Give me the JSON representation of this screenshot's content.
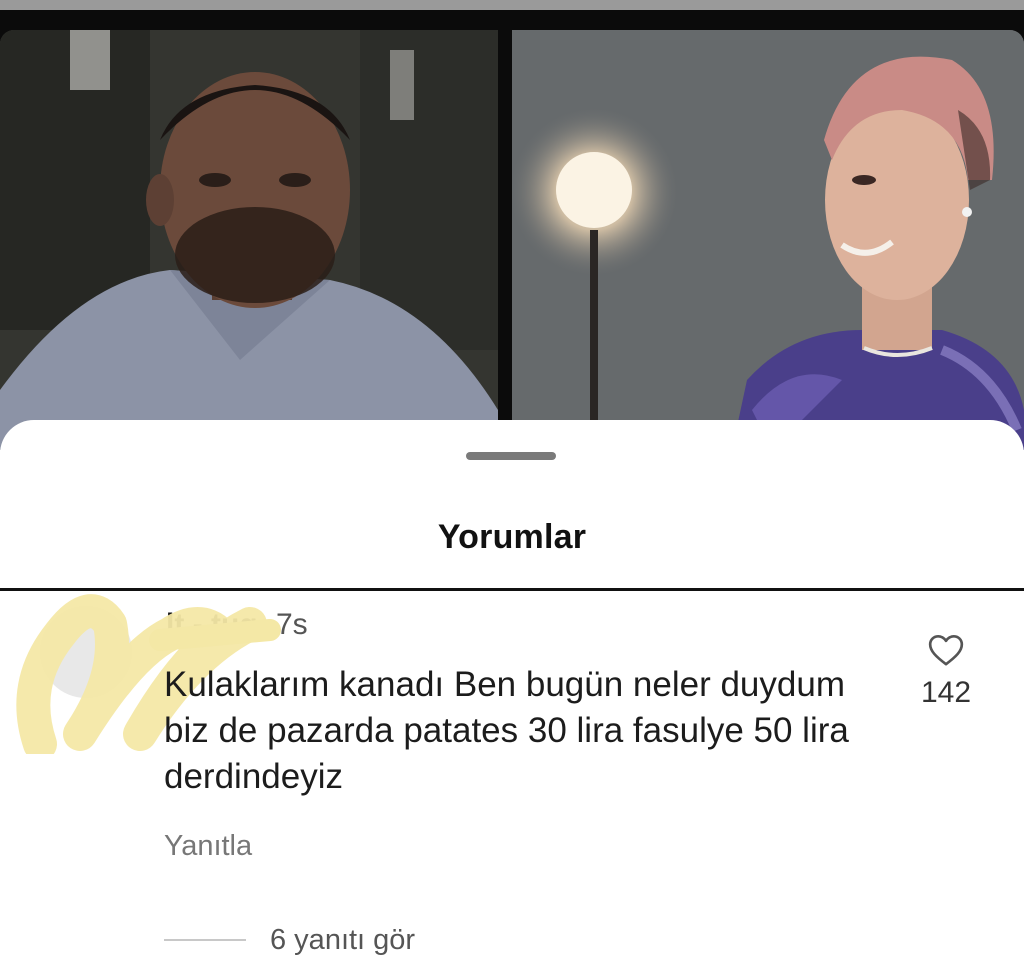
{
  "sheet": {
    "title": "Yorumlar"
  },
  "comment": {
    "username": "lt.-.tug",
    "time": "7s",
    "text": "Kulaklarım kanadı Ben bugün neler duydum biz de pazarda patates 30 lira fasulye 50 lira derdindeyiz",
    "reply_label": "Yanıtla",
    "like_count": "142",
    "view_replies_label": "6 yanıtı gör"
  },
  "icons": {
    "like": "heart-outline-icon",
    "grabber": "drag-handle-icon"
  },
  "colors": {
    "sheet_background": "#ffffff",
    "text_primary": "#111111",
    "text_secondary": "#777777",
    "redaction_scribble": "#f4e8a6"
  }
}
